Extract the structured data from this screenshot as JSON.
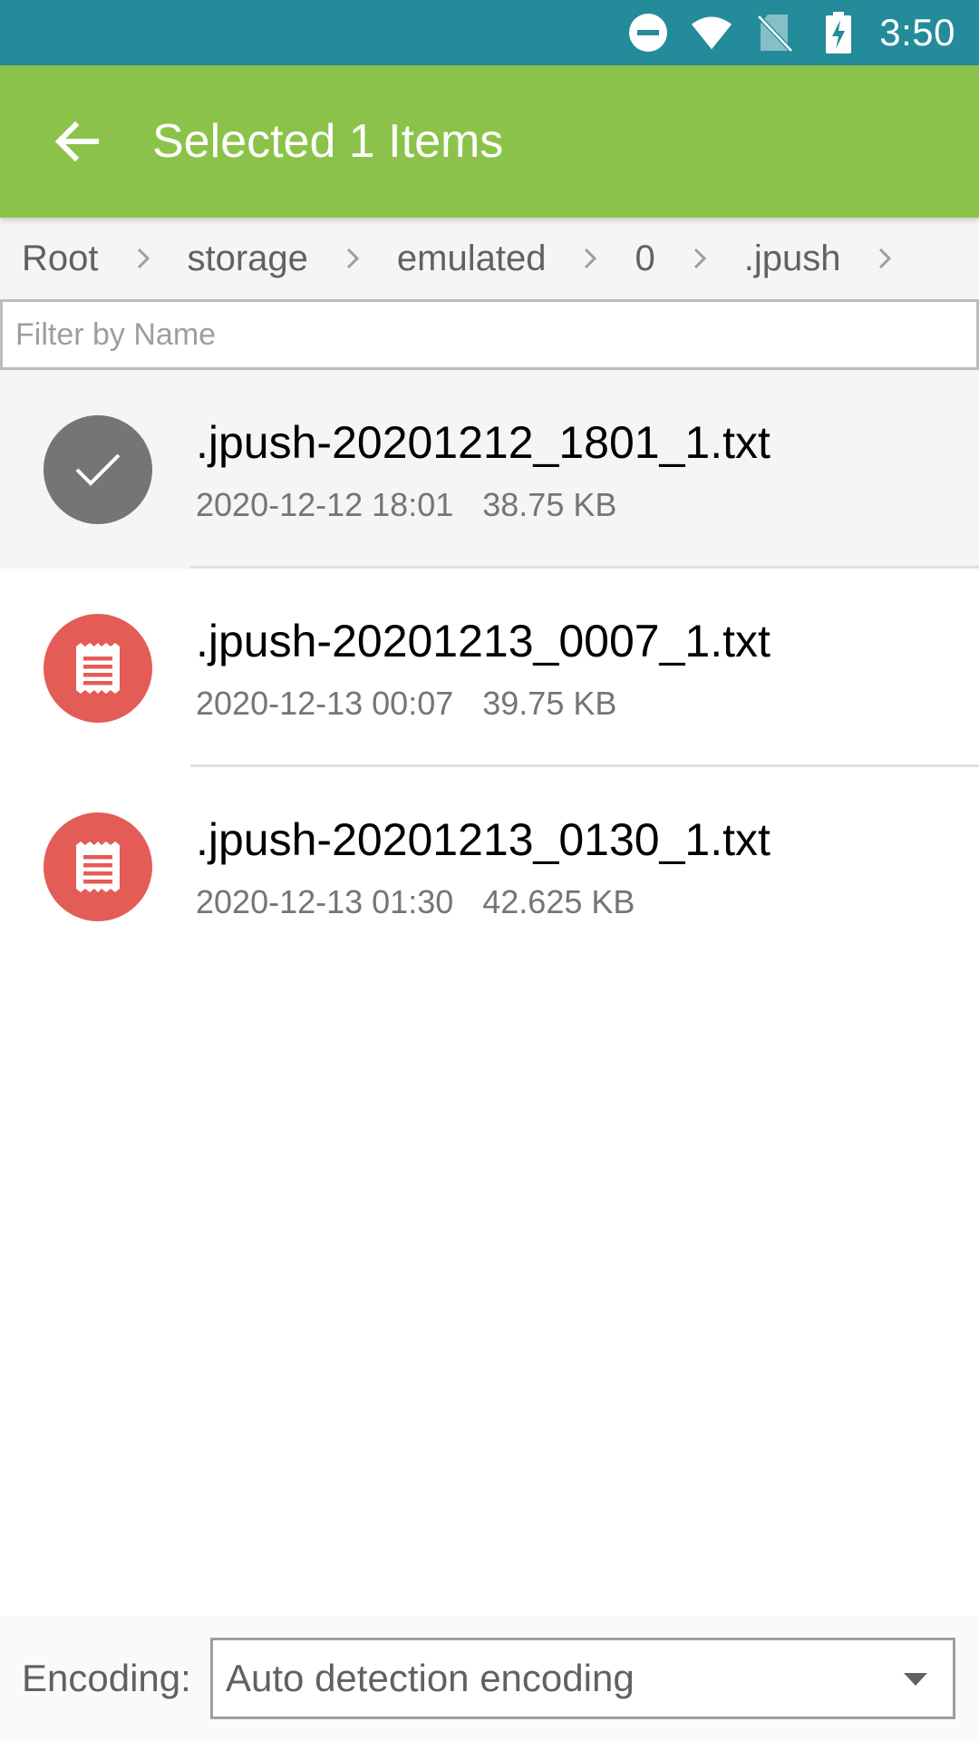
{
  "status_bar": {
    "time": "3:50",
    "icons": [
      "do-not-disturb-icon",
      "wifi-icon",
      "no-sim-icon",
      "battery-charging-icon"
    ]
  },
  "app_bar": {
    "title": "Selected 1 Items",
    "back_icon": "arrow-back-icon"
  },
  "breadcrumb": {
    "items": [
      "Root",
      "storage",
      "emulated",
      "0",
      ".jpush"
    ]
  },
  "filter": {
    "placeholder": "Filter by Name",
    "value": ""
  },
  "files": [
    {
      "name": ".jpush-20201212_1801_1.txt",
      "date": "2020-12-12 18:01",
      "size": "38.75 KB",
      "selected": true
    },
    {
      "name": ".jpush-20201213_0007_1.txt",
      "date": "2020-12-13 00:07",
      "size": "39.75 KB",
      "selected": false
    },
    {
      "name": ".jpush-20201213_0130_1.txt",
      "date": "2020-12-13 01:30",
      "size": "42.625 KB",
      "selected": false
    }
  ],
  "encoding": {
    "label": "Encoding:",
    "value": "Auto detection encoding"
  },
  "colors": {
    "status_bar": "#238b99",
    "app_bar": "#8bc34a",
    "doc_icon": "#e35d56",
    "selected_icon": "#757575"
  }
}
